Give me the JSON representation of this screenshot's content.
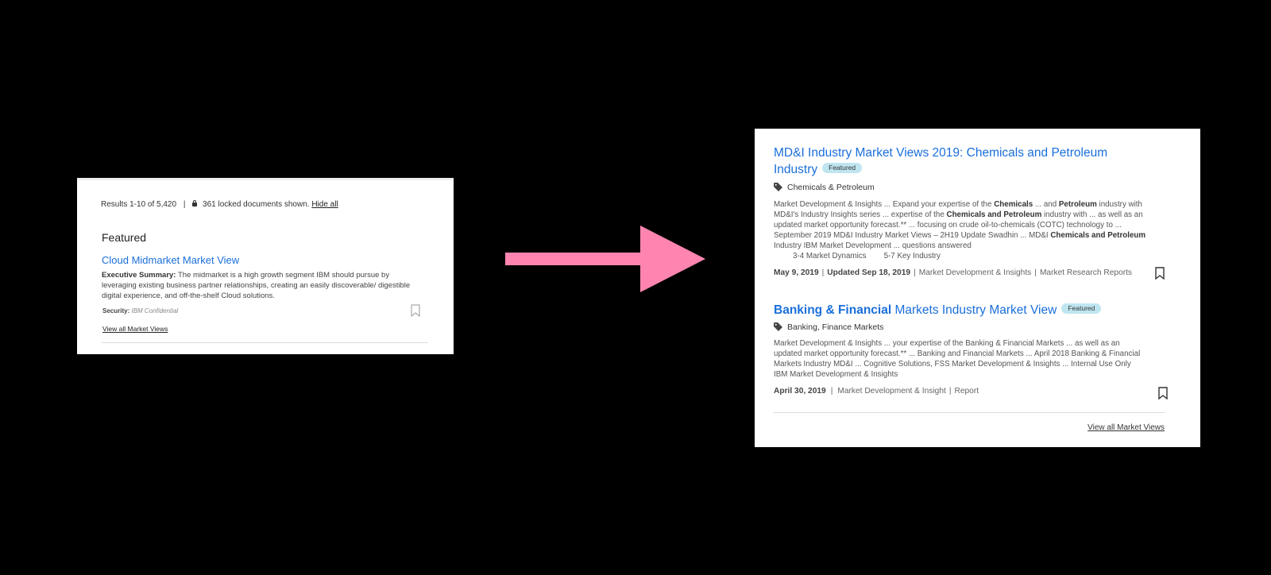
{
  "left_panel": {
    "results_text": "Results 1-10 of 5,420",
    "separator": "|",
    "locked_text": "361 locked documents shown.",
    "hide_all_label": "Hide all",
    "featured_heading": "Featured",
    "card": {
      "title": "Cloud Midmarket Market View",
      "summary_label": "Executive Summary:",
      "summary_text": "The midmarket is a high growth segment IBM should pursue by leveraging existing business partner relationships, creating an easily discoverable/ digestible digital experience, and off-the-shelf Cloud solutions.",
      "security_label": "Security:",
      "security_value": "IBM Confidential",
      "bookmark_icon": "bookmark-icon"
    },
    "view_all_label": "View all Market Views"
  },
  "arrow": {
    "color": "#ff85b0",
    "icon": "arrow-right-icon"
  },
  "right_panel": {
    "results": [
      {
        "title": "MD&I Industry Market Views 2019: Chemicals and Petroleum Industry",
        "badge": "Featured",
        "tag_icon": "tag-icon",
        "tag": "Chemicals & Petroleum",
        "snippet": {
          "p1": "Market Development & Insights ... Expand your expertise of the ",
          "b1": "Chemicals",
          "p2": " ... and ",
          "b2": "Petroleum",
          "p3": " industry with MD&I's Industry Insights series ... expertise of the ",
          "b3": "Chemicals and Petroleum",
          "p4": " industry with ... as well as an updated market opportunity forecast.** ... focusing on crude oil-to-chemicals (COTC) technology to ... September 2019 MD&I Industry Market Views – 2H19 Update Swadhin ... MD&I ",
          "b4": "Chemicals and Petroleum",
          "p5": " Industry IBM Market Development ... questions answered",
          "sub1": "3-4 Market Dynamics",
          "sub2": "5-7 Key Industry"
        },
        "date": "May 9, 2019",
        "updated": "Updated Sep 18, 2019",
        "source": "Market Development & Insights",
        "type": "Market Research Reports",
        "bookmark_icon": "bookmark-icon"
      },
      {
        "title_bold": "Banking & Financial",
        "title_rest": "Markets Industry Market View",
        "badge": "Featured",
        "tag_icon": "tag-icon",
        "tag": "Banking, Finance Markets",
        "snippet": "Market Development & Insights ... your expertise of the Banking & Financial Markets ... as well as an updated market opportunity forecast.** ... Banking and Financial Markets ... April 2018 Banking & Financial Markets Industry MD&I ... Cognitive Solutions, FSS Market Development & Insights ... Internal Use Only IBM Market Development & Insights",
        "date": "April 30, 2019",
        "source": "Market Development & Insight",
        "type": "Report",
        "bookmark_icon": "bookmark-icon"
      }
    ],
    "separator": "|",
    "view_all_label": "View all Market Views"
  }
}
